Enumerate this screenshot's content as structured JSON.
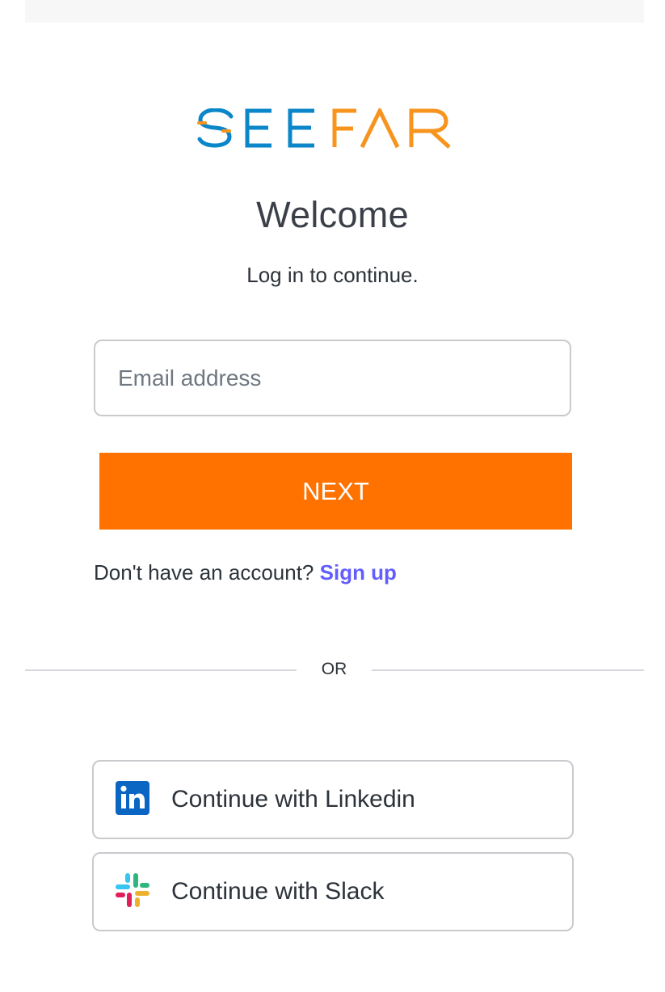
{
  "brand": {
    "name": "SEEFAR",
    "colors": {
      "blue": "#0b86c8",
      "orange": "#f7941d"
    }
  },
  "login": {
    "title": "Welcome",
    "subtitle": "Log in to continue.",
    "email_placeholder": "Email address",
    "email_value": "",
    "next_label": "NEXT",
    "signup_prompt": "Don't have an account?",
    "signup_link": "Sign up",
    "divider": "OR",
    "accent_color": "#ff7200",
    "link_color": "#635dff"
  },
  "social": [
    {
      "label": "Continue with Linkedin",
      "icon": "linkedin-icon"
    },
    {
      "label": "Continue with Slack",
      "icon": "slack-icon"
    }
  ]
}
